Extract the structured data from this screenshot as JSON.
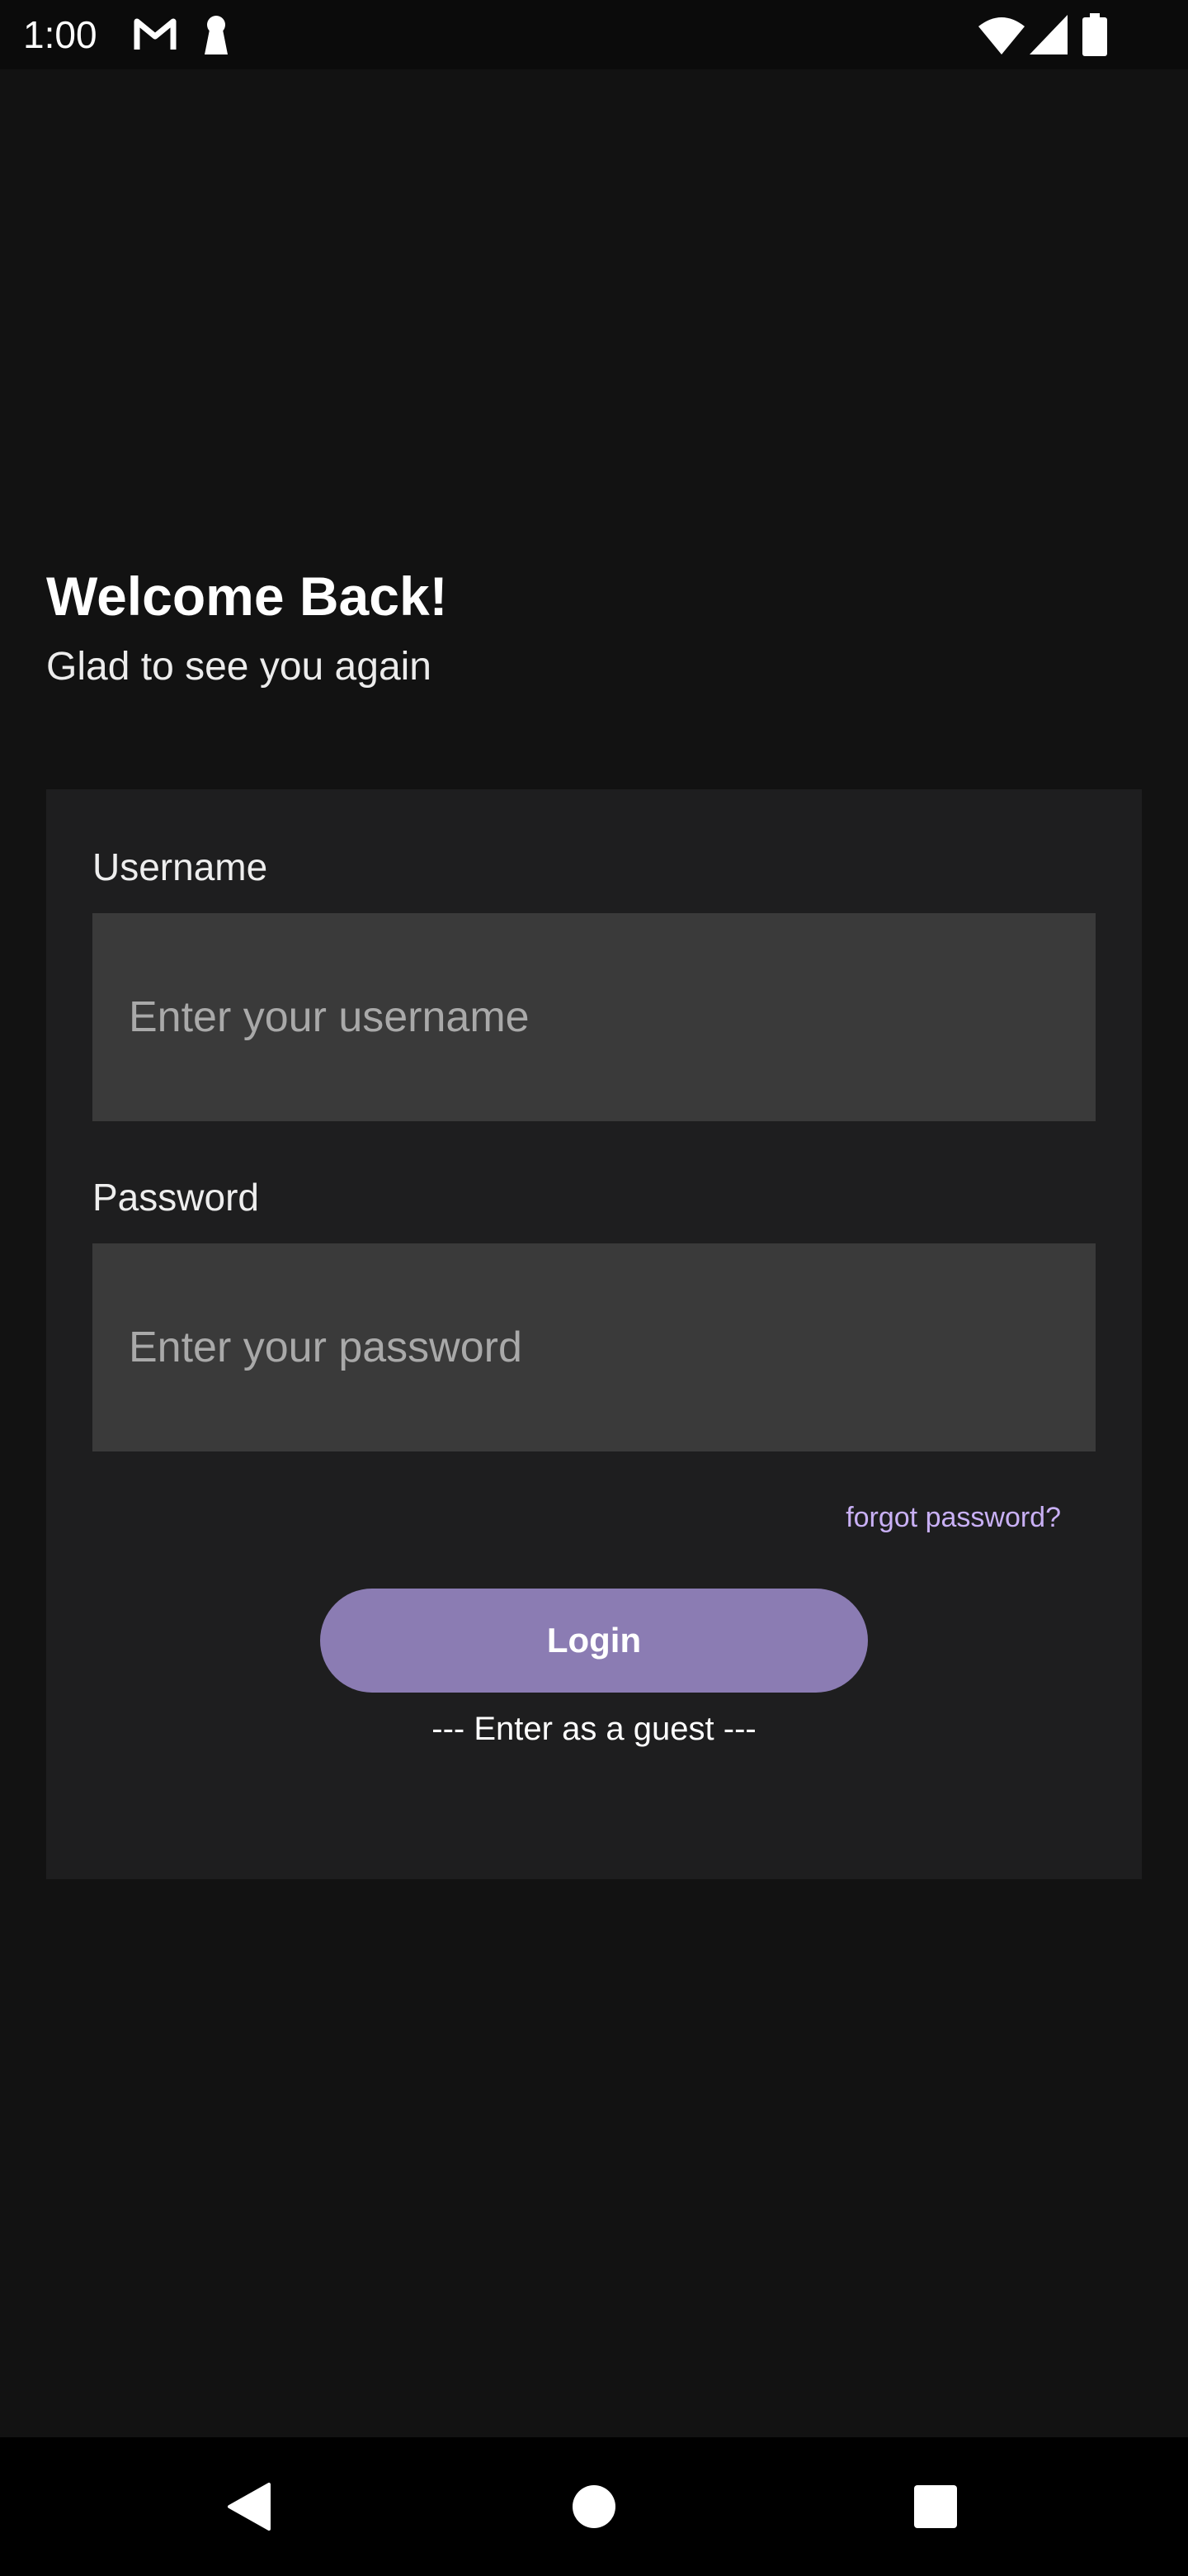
{
  "status_bar": {
    "time": "1:00",
    "left_icons": [
      "gmail-icon",
      "keyhole-icon"
    ],
    "right_icons": [
      "wifi-icon",
      "cellular-signal-icon",
      "battery-icon"
    ]
  },
  "header": {
    "title": "Welcome Back!",
    "subtitle": "Glad to see you again"
  },
  "form": {
    "username_label": "Username",
    "username_placeholder": "Enter your username",
    "username_value": "",
    "password_label": "Password",
    "password_placeholder": "Enter your password",
    "password_value": "",
    "forgot_password": "forgot password?",
    "login_button": "Login",
    "guest_link": "--- Enter as a guest ---"
  },
  "nav_bar": {
    "icons": [
      "back-icon",
      "home-icon",
      "recents-icon"
    ]
  },
  "colors": {
    "background": "#121212",
    "card": "#1e1e1f",
    "input": "#3a3a3a",
    "accent_button": "#8b7cb3",
    "link": "#c9b0f5"
  }
}
